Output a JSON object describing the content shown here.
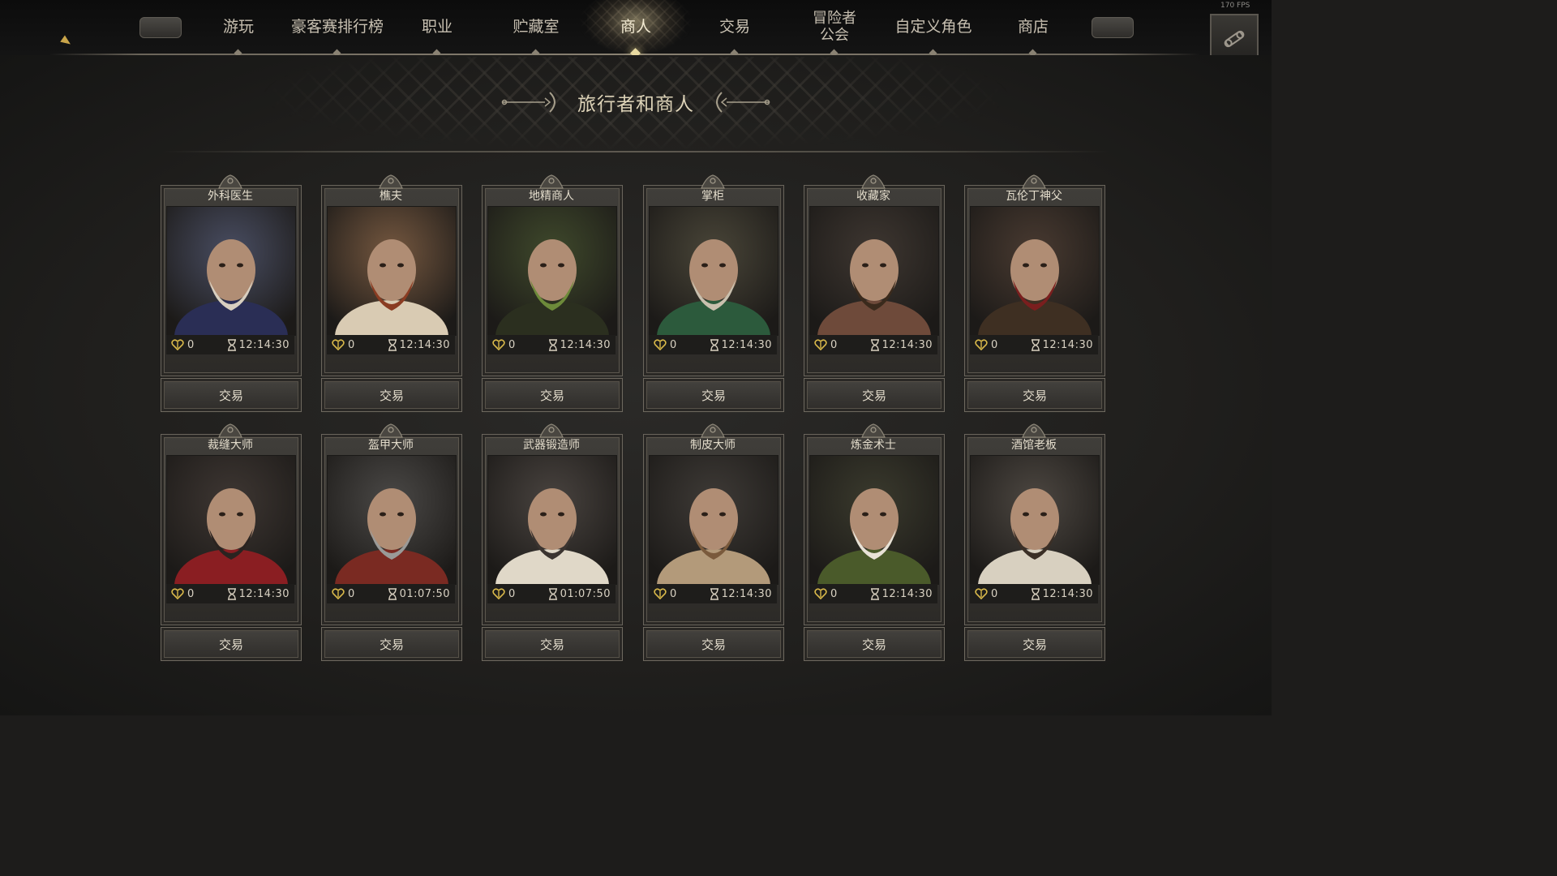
{
  "fps": "170 FPS",
  "nav": [
    {
      "label": "游玩"
    },
    {
      "label": "豪客赛排行榜"
    },
    {
      "label": "职业"
    },
    {
      "label": "贮藏室"
    },
    {
      "label": "商人",
      "active": true
    },
    {
      "label": "交易"
    },
    {
      "label": "冒险者\n公会"
    },
    {
      "label": "自定义角色"
    },
    {
      "label": "商店"
    }
  ],
  "nav_line2": "公会",
  "nav_line1": "冒险者",
  "page_title": "旅行者和商人",
  "accent_color": "#e7d9a0",
  "merchants": [
    {
      "name": "外科医生",
      "reputation": "0",
      "timer": "12:14:30",
      "button": "交易"
    },
    {
      "name": "樵夫",
      "reputation": "0",
      "timer": "12:14:30",
      "button": "交易"
    },
    {
      "name": "地精商人",
      "reputation": "0",
      "timer": "12:14:30",
      "button": "交易"
    },
    {
      "name": "掌柜",
      "reputation": "0",
      "timer": "12:14:30",
      "button": "交易"
    },
    {
      "name": "收藏家",
      "reputation": "0",
      "timer": "12:14:30",
      "button": "交易"
    },
    {
      "name": "瓦伦丁神父",
      "reputation": "0",
      "timer": "12:14:30",
      "button": "交易"
    },
    {
      "name": "裁缝大师",
      "reputation": "0",
      "timer": "12:14:30",
      "button": "交易"
    },
    {
      "name": "盔甲大师",
      "reputation": "0",
      "timer": "01:07:50",
      "button": "交易"
    },
    {
      "name": "武器锻造师",
      "reputation": "0",
      "timer": "01:07:50",
      "button": "交易"
    },
    {
      "name": "制皮大师",
      "reputation": "0",
      "timer": "12:14:30",
      "button": "交易"
    },
    {
      "name": "炼金术士",
      "reputation": "0",
      "timer": "12:14:30",
      "button": "交易"
    },
    {
      "name": "酒馆老板",
      "reputation": "0",
      "timer": "12:14:30",
      "button": "交易"
    }
  ]
}
